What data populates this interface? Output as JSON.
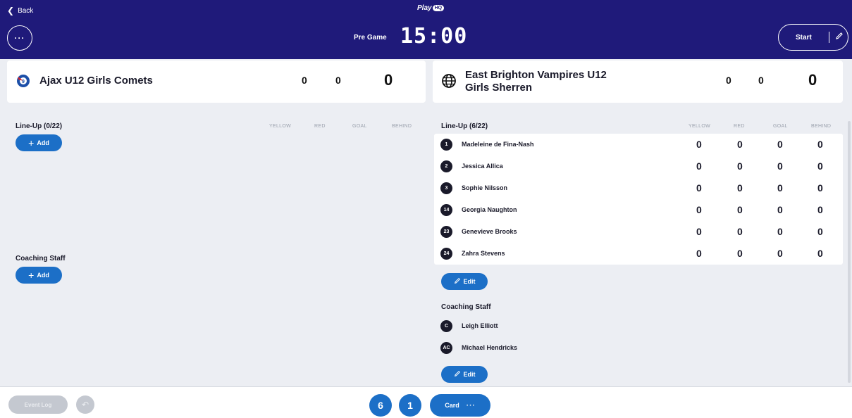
{
  "header": {
    "back_label": "Back",
    "logo_text": "Play",
    "logo_badge": "HQ",
    "menu_icon": "ellipsis-icon",
    "status": "Pre Game",
    "clock": "15:00",
    "start_label": "Start",
    "colors": {
      "background": "#1f1a7a",
      "text": "#ffffff"
    }
  },
  "home": {
    "name": "Ajax U12 Girls Comets",
    "score_a": "0",
    "score_b": "0",
    "total": "0",
    "lineup_title": "Line-Up (0/22)",
    "columns": [
      "YELLOW",
      "RED",
      "GOAL",
      "BEHIND"
    ],
    "add_label": "Add",
    "coaching_title": "Coaching Staff",
    "coaching_add_label": "Add"
  },
  "away": {
    "name": "East Brighton Vampires U12 Girls Sherren",
    "score_a": "0",
    "score_b": "0",
    "total": "0",
    "lineup_title": "Line-Up (6/22)",
    "columns": [
      "YELLOW",
      "RED",
      "GOAL",
      "BEHIND"
    ],
    "players": [
      {
        "number": "1",
        "name": "Madeleine de Fina-Nash",
        "yellow": "0",
        "red": "0",
        "goal": "0",
        "behind": "0"
      },
      {
        "number": "2",
        "name": "Jessica Allica",
        "yellow": "0",
        "red": "0",
        "goal": "0",
        "behind": "0"
      },
      {
        "number": "3",
        "name": "Sophie Nilsson",
        "yellow": "0",
        "red": "0",
        "goal": "0",
        "behind": "0"
      },
      {
        "number": "14",
        "name": "Georgia Naughton",
        "yellow": "0",
        "red": "0",
        "goal": "0",
        "behind": "0"
      },
      {
        "number": "23",
        "name": "Genevieve Brooks",
        "yellow": "0",
        "red": "0",
        "goal": "0",
        "behind": "0"
      },
      {
        "number": "24",
        "name": "Zahra Stevens",
        "yellow": "0",
        "red": "0",
        "goal": "0",
        "behind": "0"
      }
    ],
    "edit_label": "Edit",
    "coaching_title": "Coaching Staff",
    "staff": [
      {
        "initials": "C",
        "name": "Leigh Elliott"
      },
      {
        "initials": "AC",
        "name": "Michael Hendricks"
      }
    ],
    "staff_edit_label": "Edit"
  },
  "footer": {
    "event_log_label": "Event Log",
    "undo_icon": "undo-icon",
    "home_count": "6",
    "away_count": "1",
    "card_label": "Card",
    "accent": "#1c6fc7"
  }
}
